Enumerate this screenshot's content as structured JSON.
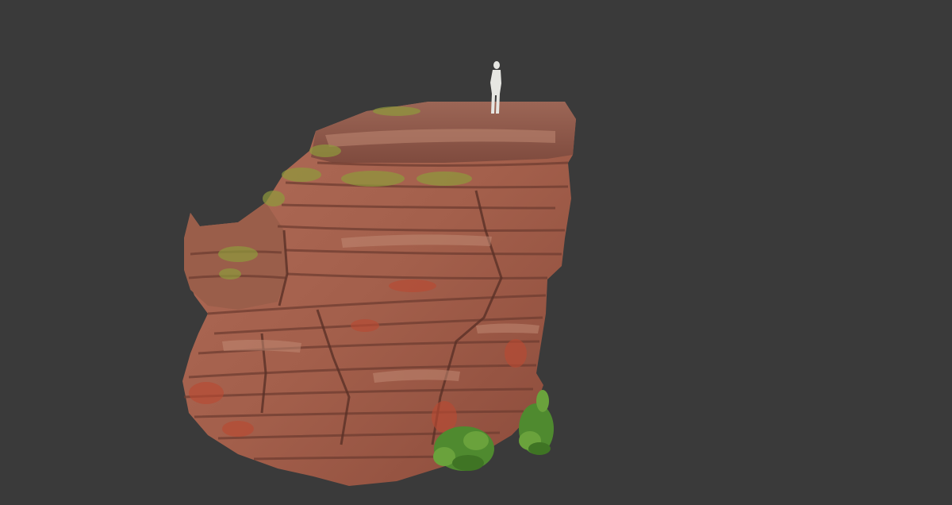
{
  "viewport": {
    "background_color": "#3a3a3a"
  },
  "scene": {
    "subject": "sandstone-rock-formation",
    "colors": {
      "rock_base": "#a4624e",
      "rock_light": "#c08872",
      "rock_dark": "#6f3d31",
      "rock_red": "#b94a32",
      "moss": "#8f9a3c",
      "shrub": "#4f8a2f",
      "scale_figure": "#e6e6e2"
    }
  }
}
